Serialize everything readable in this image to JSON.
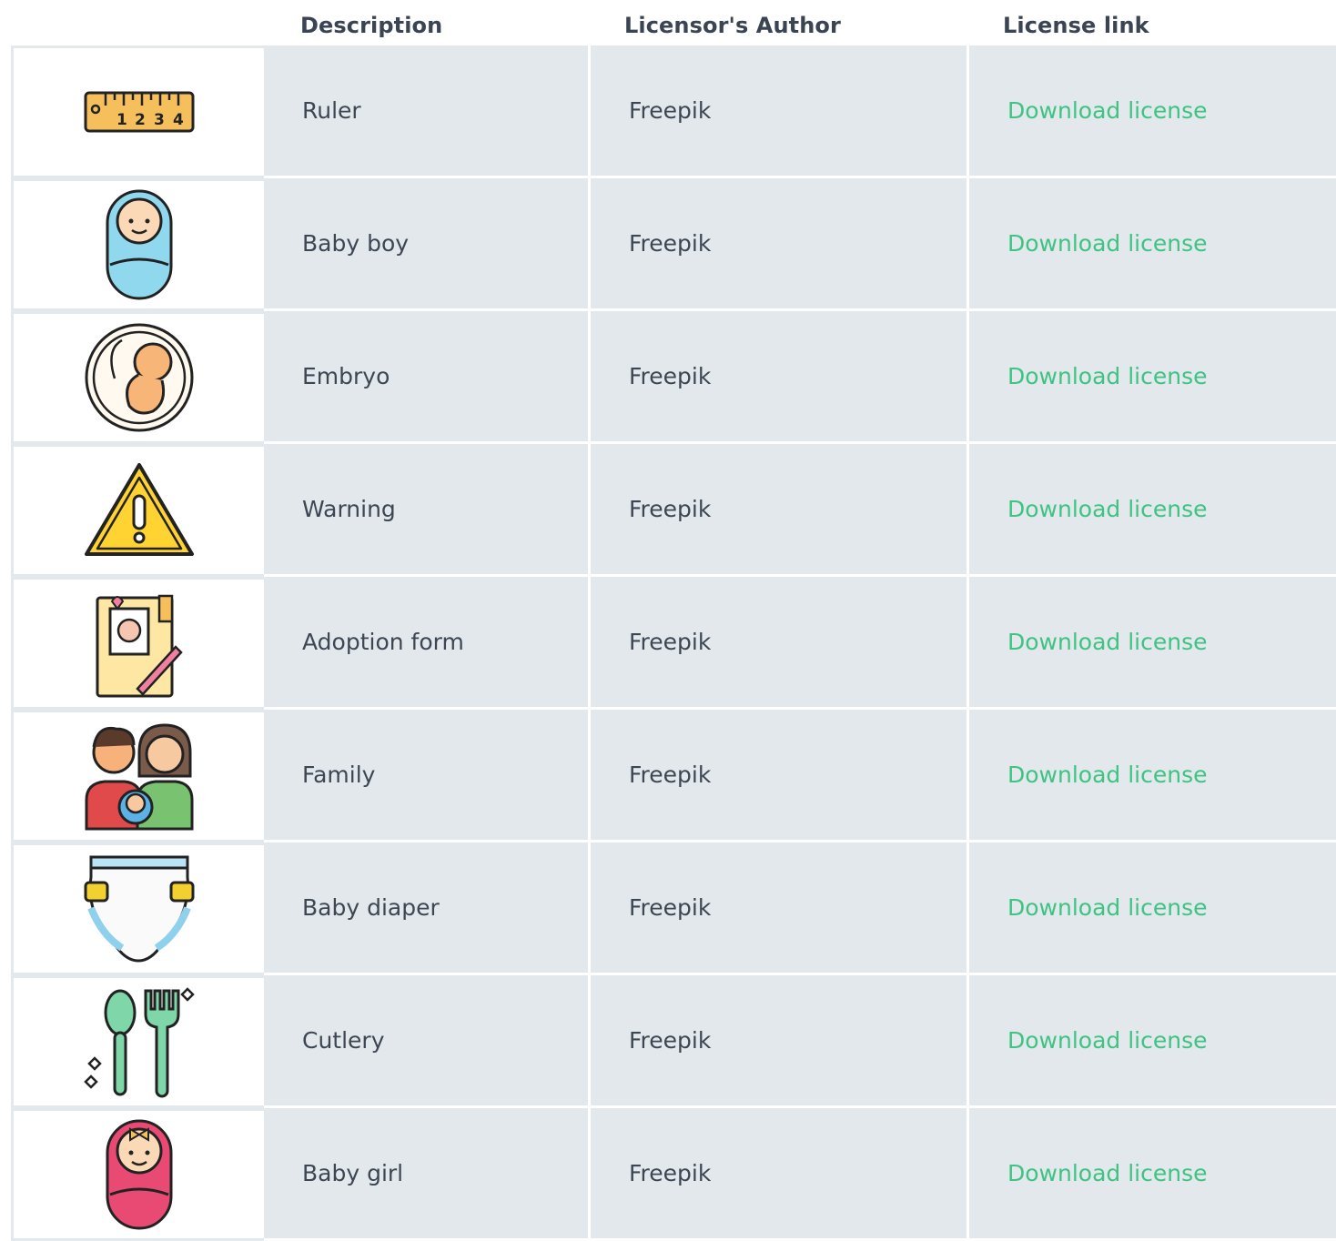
{
  "header": {
    "description": "Description",
    "author": "Licensor's Author",
    "link": "License link"
  },
  "rows": [
    {
      "icon": "ruler-icon",
      "description": "Ruler",
      "author": "Freepik",
      "link": "Download license"
    },
    {
      "icon": "baby-boy-icon",
      "description": "Baby boy",
      "author": "Freepik",
      "link": "Download license"
    },
    {
      "icon": "embryo-icon",
      "description": "Embryo",
      "author": "Freepik",
      "link": "Download license"
    },
    {
      "icon": "warning-icon",
      "description": "Warning",
      "author": "Freepik",
      "link": "Download license"
    },
    {
      "icon": "adoption-form-icon",
      "description": "Adoption form",
      "author": "Freepik",
      "link": "Download license"
    },
    {
      "icon": "family-icon",
      "description": "Family",
      "author": "Freepik",
      "link": "Download license"
    },
    {
      "icon": "baby-diaper-icon",
      "description": "Baby diaper",
      "author": "Freepik",
      "link": "Download license"
    },
    {
      "icon": "cutlery-icon",
      "description": "Cutlery",
      "author": "Freepik",
      "link": "Download license"
    },
    {
      "icon": "baby-girl-icon",
      "description": "Baby girl",
      "author": "Freepik",
      "link": "Download license"
    }
  ],
  "colors": {
    "cell_bg": "#e3e8ec",
    "link": "#3fc382",
    "text": "#3d4753"
  }
}
